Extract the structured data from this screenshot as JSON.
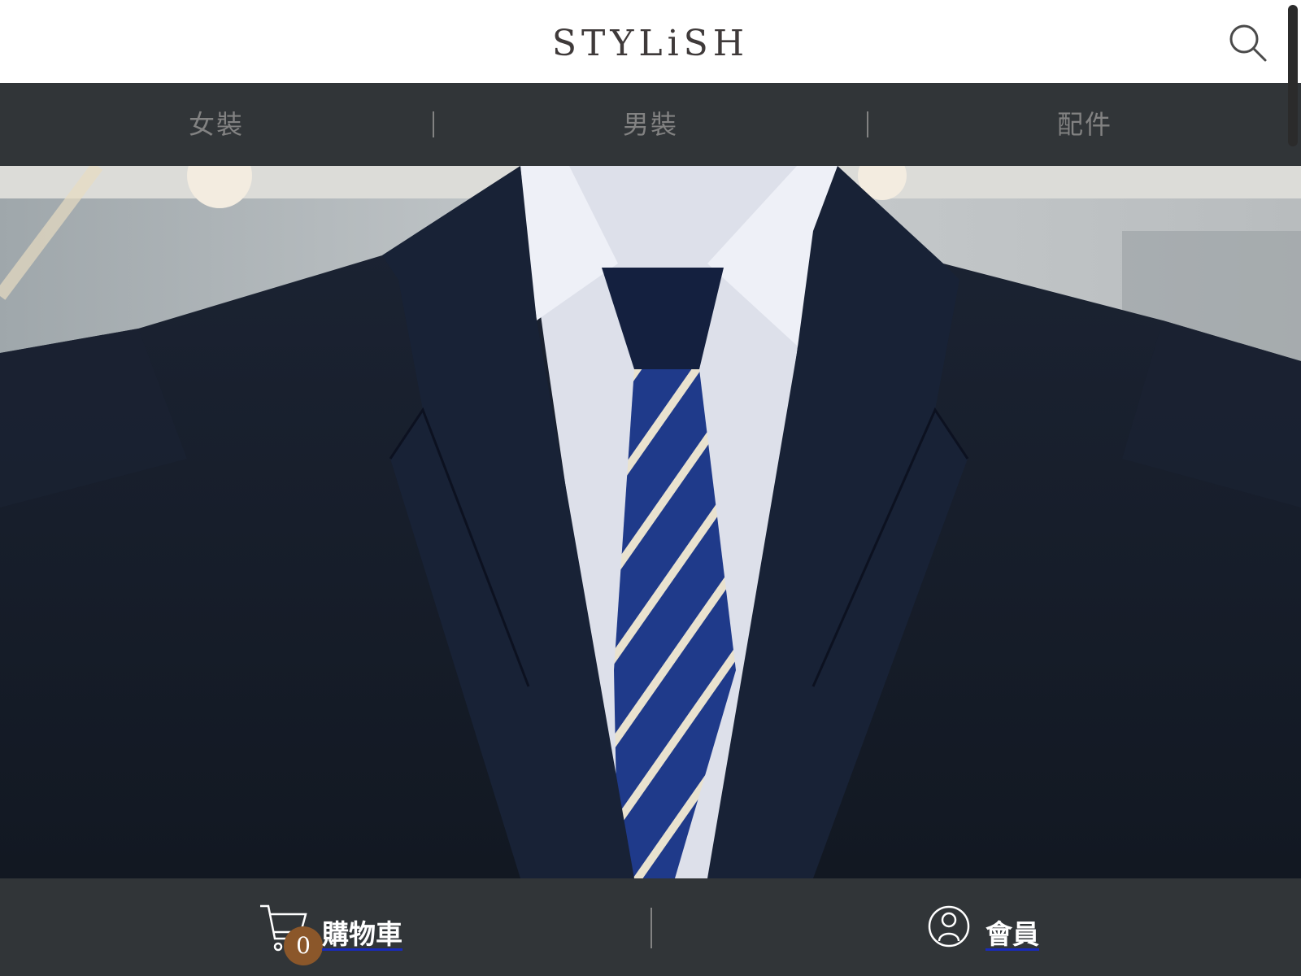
{
  "header": {
    "logo_text": "STYLiSH",
    "search_icon": "search-icon"
  },
  "nav": {
    "items": [
      {
        "label": "女裝"
      },
      {
        "label": "男裝"
      },
      {
        "label": "配件"
      }
    ]
  },
  "hero": {
    "image_description_icon": "hero-banner-image"
  },
  "bottom_bar": {
    "cart": {
      "label": "購物車",
      "count": "0",
      "icon": "cart-icon"
    },
    "member": {
      "label": "會員",
      "icon": "member-icon"
    }
  },
  "colors": {
    "nav_bg": "#313538",
    "nav_text": "#828282",
    "badge": "#8b572a",
    "logo": "#3f3a3a"
  }
}
